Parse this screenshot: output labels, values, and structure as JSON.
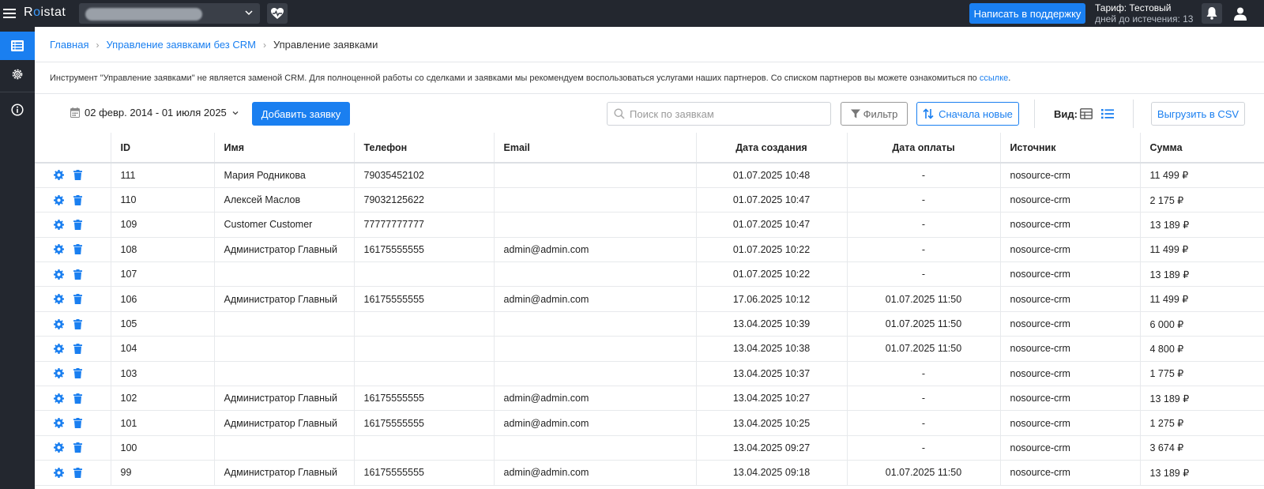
{
  "topbar": {
    "logo_pre": "R",
    "logo_dot": "o",
    "logo_post": "istat",
    "support_label": "Написать в поддержку",
    "tariff_label": "Тариф: Тестовый",
    "days_label": "дней до истечения: 13"
  },
  "breadcrumb": {
    "home": "Главная",
    "section": "Управление заявками без CRM",
    "current": "Управление заявками"
  },
  "notice": {
    "text": "Инструмент \"Управление заявками\" не является заменой CRM. Для полноценной работы со сделками и заявками мы рекомендуем воспользоваться услугами наших партнеров. Со списком партнеров вы можете ознакомиться по ",
    "link": "ссылке",
    "end": "."
  },
  "toolbar": {
    "date_range": "02 февр. 2014 - 01 июля 2025",
    "add_label": "Добавить заявку",
    "search_placeholder": "Поиск по заявкам",
    "filter_label": "Фильтр",
    "sort_label": "Сначала новые",
    "view_label": "Вид:",
    "csv_label": "Выгрузить в CSV"
  },
  "table": {
    "headers": [
      "",
      "ID",
      "Имя",
      "Телефон",
      "Email",
      "Дата создания",
      "Дата оплаты",
      "Источник",
      "Сумма"
    ],
    "rows": [
      [
        "111",
        "Мария Родникова",
        "79035452102",
        "",
        "01.07.2025 10:48",
        "-",
        "nosource-crm",
        "11 499 ₽"
      ],
      [
        "110",
        "Алексей Маслов",
        "79032125622",
        "",
        "01.07.2025 10:47",
        "-",
        "nosource-crm",
        "2 175 ₽"
      ],
      [
        "109",
        "Customer Customer",
        "77777777777",
        "",
        "01.07.2025 10:47",
        "-",
        "nosource-crm",
        "13 189 ₽"
      ],
      [
        "108",
        "Администратор Главный",
        "16175555555",
        "admin@admin.com",
        "01.07.2025 10:22",
        "-",
        "nosource-crm",
        "11 499 ₽"
      ],
      [
        "107",
        "",
        "",
        "",
        "01.07.2025 10:22",
        "-",
        "nosource-crm",
        "13 189 ₽"
      ],
      [
        "106",
        "Администратор Главный",
        "16175555555",
        "admin@admin.com",
        "17.06.2025 10:12",
        "01.07.2025 11:50",
        "nosource-crm",
        "11 499 ₽"
      ],
      [
        "105",
        "",
        "",
        "",
        "13.04.2025 10:39",
        "01.07.2025 11:50",
        "nosource-crm",
        "6 000 ₽"
      ],
      [
        "104",
        "",
        "",
        "",
        "13.04.2025 10:38",
        "01.07.2025 11:50",
        "nosource-crm",
        "4 800 ₽"
      ],
      [
        "103",
        "",
        "",
        "",
        "13.04.2025 10:37",
        "-",
        "nosource-crm",
        "1 775 ₽"
      ],
      [
        "102",
        "Администратор Главный",
        "16175555555",
        "admin@admin.com",
        "13.04.2025 10:27",
        "-",
        "nosource-crm",
        "13 189 ₽"
      ],
      [
        "101",
        "Администратор Главный",
        "16175555555",
        "admin@admin.com",
        "13.04.2025 10:25",
        "-",
        "nosource-crm",
        "1 275 ₽"
      ],
      [
        "100",
        "",
        "",
        "",
        "13.04.2025 09:27",
        "-",
        "nosource-crm",
        "3 674 ₽"
      ],
      [
        "99",
        "Администратор Главный",
        "16175555555",
        "admin@admin.com",
        "13.04.2025 09:18",
        "01.07.2025 11:50",
        "nosource-crm",
        "13 189 ₽"
      ]
    ]
  },
  "colors": {
    "accent": "#1a7ff0",
    "dark": "#23272f"
  },
  "icons": {
    "row_settings": "gear-icon",
    "row_delete": "trash-icon"
  }
}
